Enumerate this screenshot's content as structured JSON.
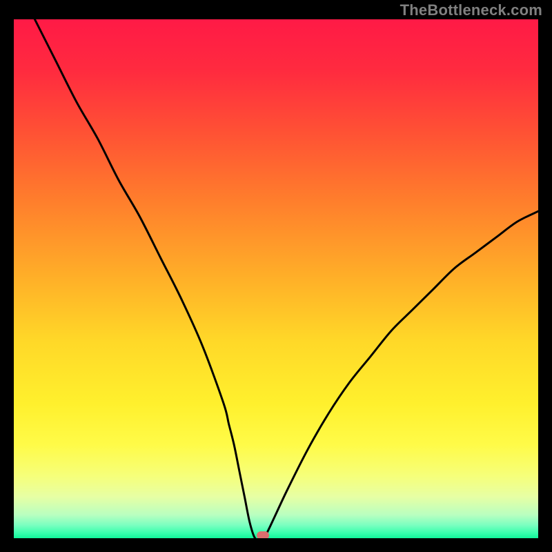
{
  "watermark": {
    "text": "TheBottleneck.com"
  },
  "gradient": {
    "stops": [
      {
        "offset": 0.0,
        "color": "#ff1a46"
      },
      {
        "offset": 0.1,
        "color": "#ff2b3f"
      },
      {
        "offset": 0.22,
        "color": "#ff5234"
      },
      {
        "offset": 0.35,
        "color": "#ff7e2c"
      },
      {
        "offset": 0.5,
        "color": "#ffb028"
      },
      {
        "offset": 0.62,
        "color": "#ffd828"
      },
      {
        "offset": 0.74,
        "color": "#fff02d"
      },
      {
        "offset": 0.82,
        "color": "#fffb48"
      },
      {
        "offset": 0.88,
        "color": "#f6ff7a"
      },
      {
        "offset": 0.92,
        "color": "#e7ffa4"
      },
      {
        "offset": 0.955,
        "color": "#b9ffc0"
      },
      {
        "offset": 0.975,
        "color": "#7affc0"
      },
      {
        "offset": 0.99,
        "color": "#38ffad"
      },
      {
        "offset": 1.0,
        "color": "#11f59a"
      }
    ]
  },
  "chart_data": {
    "type": "line",
    "title": "",
    "xlabel": "",
    "ylabel": "",
    "xlim": [
      0,
      100
    ],
    "ylim": [
      0,
      100
    ],
    "grid": false,
    "series": [
      {
        "name": "bottleneck-curve",
        "x": [
          4,
          8,
          12,
          16,
          20,
          24,
          28,
          32,
          36,
          40,
          41,
          42,
          43,
          44,
          45,
          46,
          47,
          48,
          52,
          56,
          60,
          64,
          68,
          72,
          76,
          80,
          84,
          88,
          92,
          96,
          100
        ],
        "values": [
          100,
          92,
          84,
          77,
          69,
          62,
          54,
          46,
          37,
          26,
          22,
          18,
          13,
          8,
          3,
          0,
          0,
          0.5,
          9,
          17,
          24,
          30,
          35,
          40,
          44,
          48,
          52,
          55,
          58,
          61,
          63
        ]
      }
    ],
    "marker": {
      "x": 47.5,
      "y": 0.5
    },
    "legend": false
  }
}
